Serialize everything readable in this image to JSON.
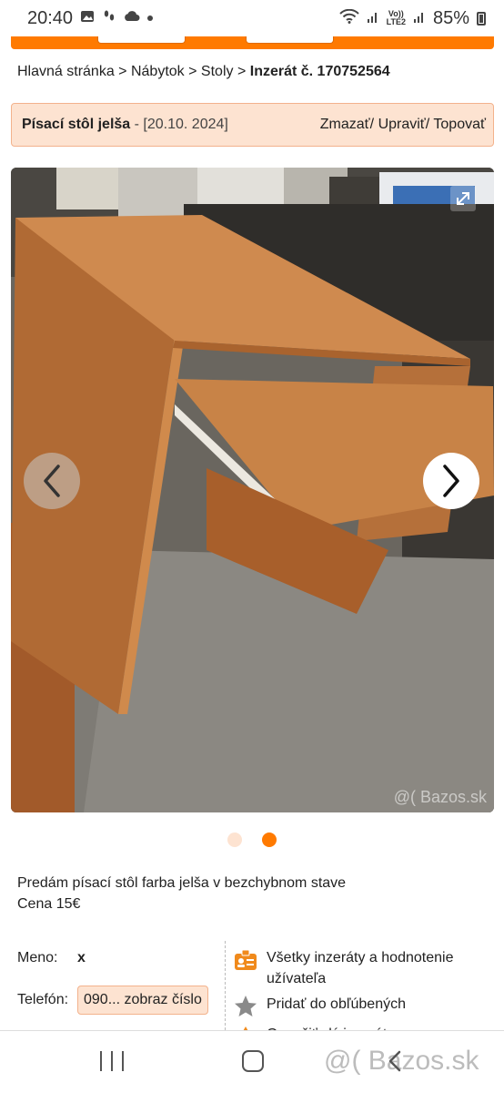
{
  "status_bar": {
    "time": "20:40",
    "network_top": "Vo))",
    "network_bottom": "LTE2",
    "battery": "85%"
  },
  "breadcrumb": {
    "items": [
      "Hlavná stránka",
      "Nábytok",
      "Stoly"
    ],
    "separator": ">",
    "current": "Inzerát č. 170752564"
  },
  "listing": {
    "title": "Písací stôl jelša",
    "date": "[20.10. 2024]",
    "actions": "Zmazať/ Upraviť/ Topovať"
  },
  "gallery": {
    "watermark": "@( Bazos.sk",
    "image_count": 2,
    "active_index": 1
  },
  "description": {
    "line1": "Predám písací stôl farba jelša v bezchybnom stave",
    "line2": "Cena 15€"
  },
  "seller": {
    "name_label": "Meno:",
    "name_value": "x",
    "phone_label": "Telefón:",
    "phone_button": "090... zobraz číslo"
  },
  "links": {
    "all_ads": "Všetky inzeráty a hodnotenie užívateľa",
    "favorite": "Pridať do obľúbených",
    "report": "Označiť zlý inzerát"
  },
  "bottom_nav": {
    "logo": "@( Bazos.sk"
  },
  "colors": {
    "accent": "#ff7a00",
    "title_bg": "#fde3d1",
    "title_border": "#f3b28c"
  }
}
